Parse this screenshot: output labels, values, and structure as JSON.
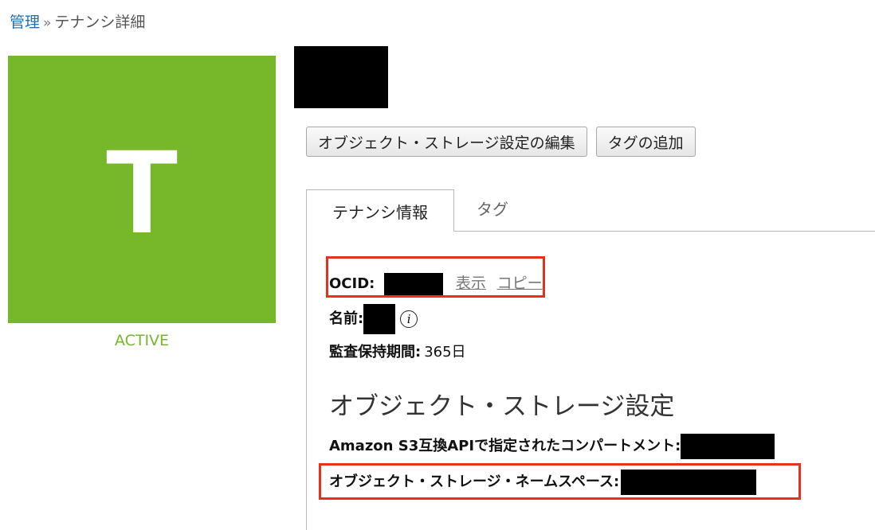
{
  "breadcrumb": {
    "root": "管理",
    "separator": "»",
    "current": "テナンシ詳細"
  },
  "tenancy": {
    "avatar_letter": "T",
    "status": "ACTIVE",
    "avatar_color": "#76b82a"
  },
  "actions": {
    "edit_storage": "オブジェクト・ストレージ設定の編集",
    "add_tag": "タグの追加"
  },
  "tabs": [
    {
      "label": "テナンシ情報",
      "active": true
    },
    {
      "label": "タグ",
      "active": false
    }
  ],
  "info": {
    "ocid_label": "OCID:",
    "show_link": "表示",
    "copy_link": "コピー",
    "name_label": "名前:",
    "audit_label": "監査保持期間:",
    "audit_value": "365日"
  },
  "storage": {
    "section_title": "オブジェクト・ストレージ設定",
    "s3_label": "Amazon S3互換APIで指定されたコンパートメント:",
    "namespace_label": "オブジェクト・ストレージ・ネームスペース:"
  },
  "colors": {
    "link": "#1f6fb2",
    "highlight": "#e8311c"
  }
}
